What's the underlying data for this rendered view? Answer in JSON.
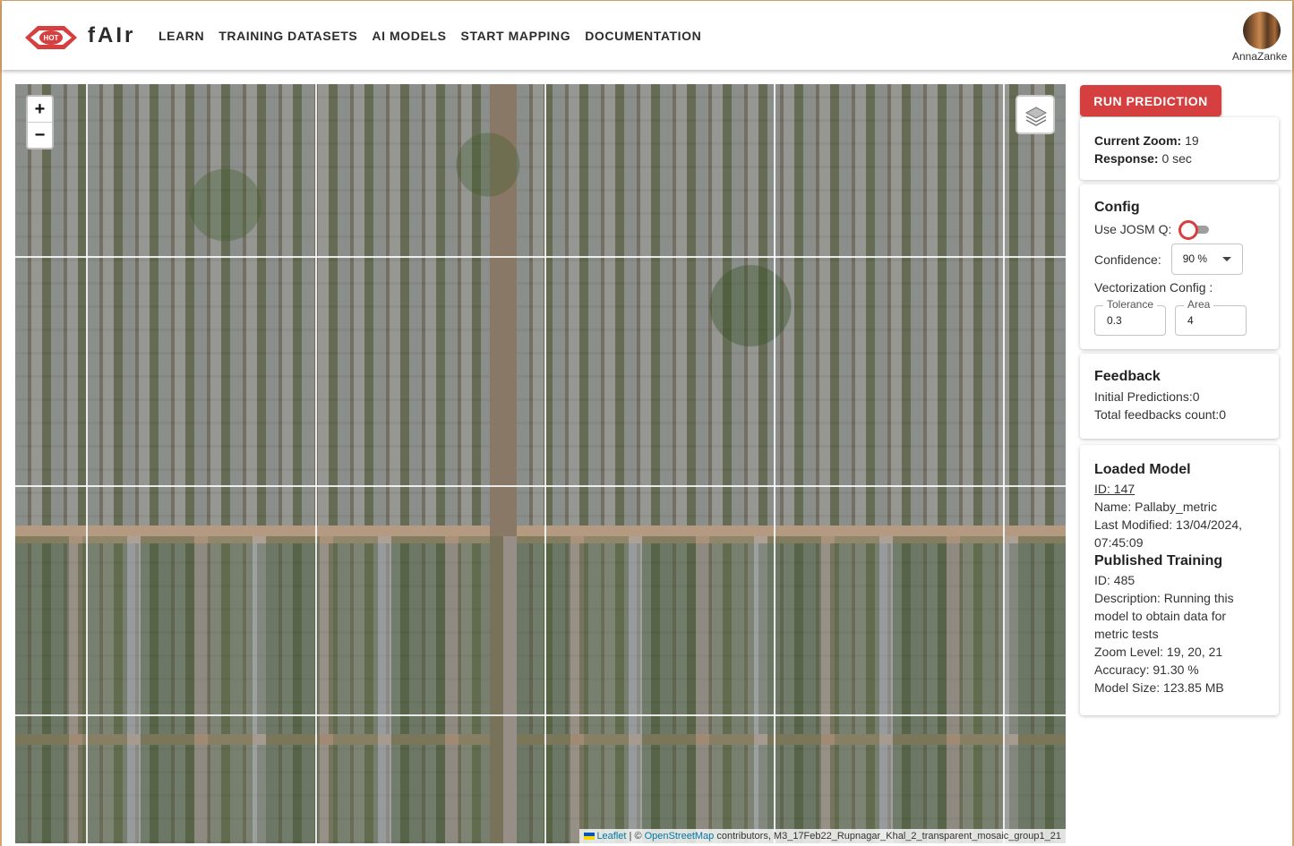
{
  "header": {
    "logo_text": "HOT",
    "brand": "fAIr",
    "nav": [
      "LEARN",
      "TRAINING DATASETS",
      "AI MODELS",
      "START MAPPING",
      "DOCUMENTATION"
    ],
    "username": "AnnaZanke"
  },
  "map": {
    "zoom_in": "+",
    "zoom_out": "−",
    "attribution": {
      "leaflet": "Leaflet",
      "sep": "| ©",
      "osm": "OpenStreetMap",
      "rest": "contributors, M3_17Feb22_Rupnagar_Khal_2_transparent_mosaic_group1_21"
    }
  },
  "panel": {
    "run_button": "RUN PREDICTION",
    "status": {
      "zoom_label": "Current Zoom:",
      "zoom_value": "19",
      "response_label": "Response:",
      "response_value": "0 sec"
    },
    "config": {
      "title": "Config",
      "josm_label": "Use JOSM Q:",
      "confidence_label": "Confidence:",
      "confidence_value": "90 %",
      "vectorization_label": "Vectorization Config :",
      "tolerance_label": "Tolerance",
      "tolerance_value": "0.3",
      "area_label": "Area",
      "area_value": "4"
    },
    "feedback": {
      "title": "Feedback",
      "initial": "Initial Predictions:0",
      "total": "Total feedbacks count:0"
    },
    "model": {
      "title": "Loaded Model",
      "id": "ID: 147",
      "name": "Name: Pallaby_metric",
      "modified_1": "Last Modified: 13/04/2024,",
      "modified_2": "07:45:09",
      "training_title": "Published Training",
      "training_id": "ID: 485",
      "desc_1": "Description: Running this",
      "desc_2": "model to obtain data for",
      "desc_3": "metric tests",
      "zoom_level": "Zoom Level: 19, 20, 21",
      "accuracy": "Accuracy: 91.30 %",
      "size": "Model Size: 123.85 MB"
    }
  },
  "colors": {
    "accent": "#d63f3f",
    "link": "#0078a8"
  }
}
